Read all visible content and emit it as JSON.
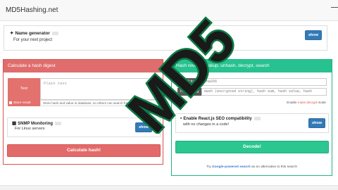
{
  "header": {
    "brand": "MD5Hashing.net"
  },
  "name_generator": {
    "title": "Name generator",
    "subtitle": "For your next project",
    "button": "show"
  },
  "calculate": {
    "heading": "Calculate a hash digest",
    "text_label": "Text",
    "textarea_placeholder": "Plain text",
    "store_label": "Store result",
    "store_note": "Store hash and value in database, so others can search for it",
    "snmp_title": "SNMP Monitoring",
    "snmp_sub": "For Linux servers",
    "snmp_button": "show",
    "submit": "Calculate hash!"
  },
  "reverse": {
    "heading": "Hash reverse lookup, unhash, decrypt, search",
    "hash_type_label": "Hash type",
    "hash_type_value": "sha256",
    "hash_string_label": "Hash String",
    "hash_string_placeholder": "Hash (encrypted string), hash sum, hash value, hash",
    "mass_prefix": "Enable ",
    "mass_link": "mass decrypt",
    "mass_suffix": " mode",
    "react_title": "Enable React.js SEO compatibility",
    "react_sub": "with no changes in a code!",
    "react_button": "show",
    "submit": "Decode!",
    "google_prefix": "Try ",
    "google_link": "Google-powered search",
    "google_suffix": " as an alternative to this search"
  },
  "overlay": {
    "text": "MD5",
    "color": "#1a1a1a",
    "outline": "#0b7a44"
  },
  "colors": {
    "red": "#e06d6d",
    "green": "#27c28f",
    "blue": "#337ab7"
  }
}
